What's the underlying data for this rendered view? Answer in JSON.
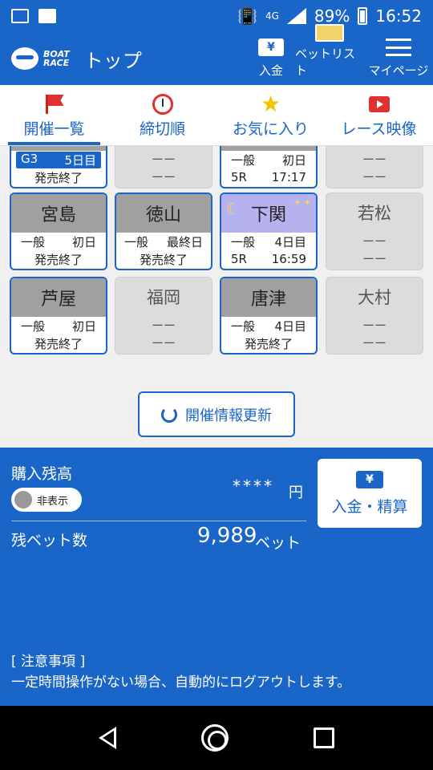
{
  "status_bar": {
    "battery": "89%",
    "time": "16:52",
    "network": "4G"
  },
  "app_bar": {
    "logo_line1": "BOAT",
    "logo_line2": "RACE",
    "title": "トップ",
    "actions": [
      {
        "label": "入金",
        "icon": "yen-icon"
      },
      {
        "label": "ベットリスト",
        "icon": "bet-ticket-icon"
      },
      {
        "label": "マイページ",
        "icon": "menu-icon"
      }
    ],
    "colors": {
      "primary": "#1a65c8"
    }
  },
  "tabs": [
    {
      "label": "開催一覧",
      "icon": "flag-icon",
      "active": true
    },
    {
      "label": "締切順",
      "icon": "alarm-clock-icon",
      "active": false
    },
    {
      "label": "お気に入り",
      "icon": "star-icon",
      "active": false
    },
    {
      "label": "レース映像",
      "icon": "video-icon",
      "active": false
    }
  ],
  "venues": {
    "row0": [
      {
        "grade": "G3",
        "day": "5日目",
        "status": "発売終了"
      },
      {
        "line1": "ーー",
        "line2": "ーー"
      },
      {
        "grade": "一般",
        "day": "初日",
        "race": "5R",
        "time": "17:17"
      },
      {
        "line1": "ーー",
        "line2": "ーー"
      }
    ],
    "row1": [
      {
        "name": "宮島",
        "grade": "一般",
        "day": "初日",
        "status": "発売終了"
      },
      {
        "name": "徳山",
        "grade": "一般",
        "day": "最終日",
        "status": "発売終了"
      },
      {
        "name": "下関",
        "grade": "一般",
        "day": "4日目",
        "race": "5R",
        "time": "16:59",
        "night": true
      },
      {
        "name": "若松",
        "line1": "ーー",
        "line2": "ーー"
      }
    ],
    "row2": [
      {
        "name": "芦屋",
        "grade": "一般",
        "day": "初日",
        "status": "発売終了"
      },
      {
        "name": "福岡",
        "line1": "ーー",
        "line2": "ーー"
      },
      {
        "name": "唐津",
        "grade": "一般",
        "day": "4日目",
        "status": "発売終了"
      },
      {
        "name": "大村",
        "line1": "ーー",
        "line2": "ーー"
      }
    ]
  },
  "refresh_button": {
    "label": "開催情報更新"
  },
  "balance": {
    "label": "購入残高",
    "toggle_label": "非表示",
    "value": "****",
    "unit": "円",
    "bets_label": "残ベット数",
    "bets_value": "9,989",
    "bets_unit": "ベット",
    "deposit_button": "入金・精算"
  },
  "notes": {
    "title": "[ 注意事項 ]",
    "text": "一定時間操作がない場合、自動的にログアウトします。"
  }
}
